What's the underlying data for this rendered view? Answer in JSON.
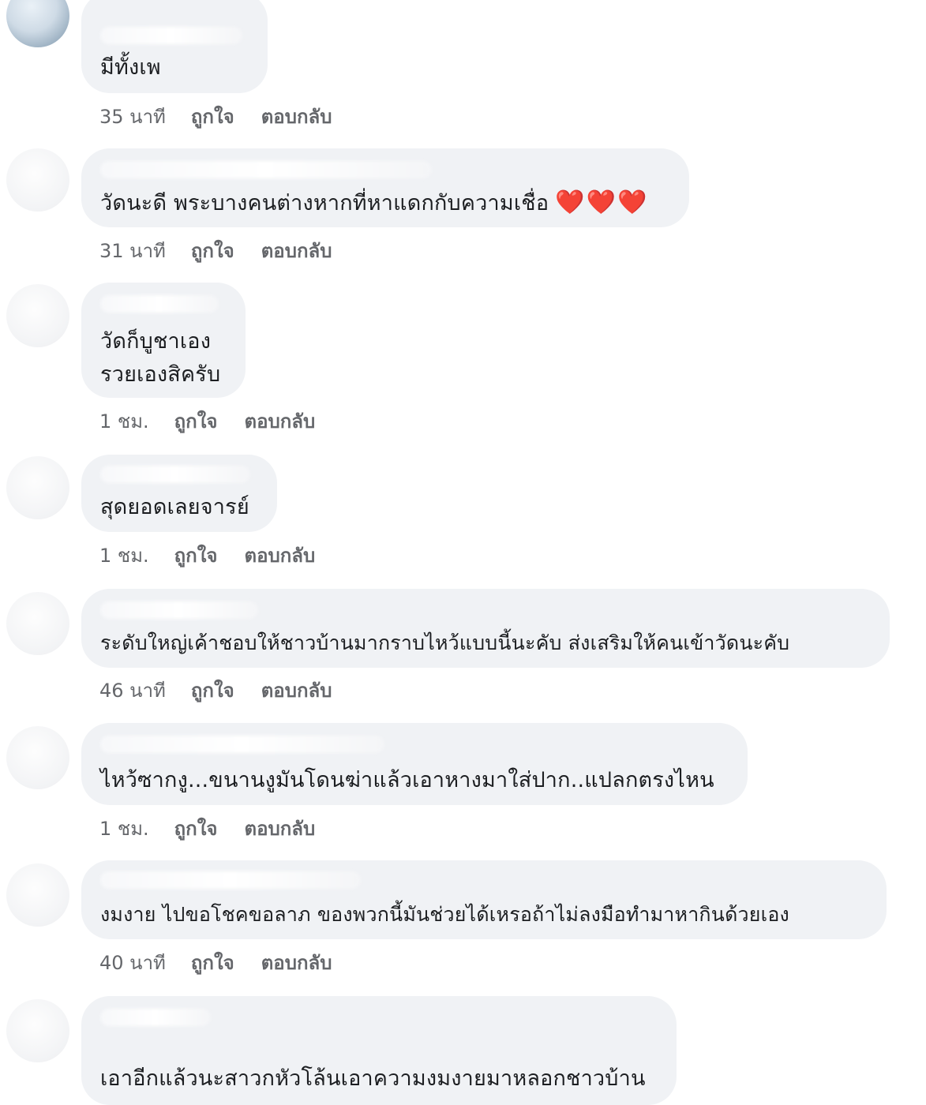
{
  "labels": {
    "like": "ถูกใจ",
    "reply": "ตอบกลับ"
  },
  "comments": [
    {
      "text_lines": [
        "มีทั้งเพ"
      ],
      "time": "35 นาที",
      "avatar_icon": "profile-photo-icon"
    },
    {
      "text_lines": [
        "วัดนะดี พระบางคนต่างหากที่หาแดกกับความเชื่อ"
      ],
      "emoji": "❤️❤️❤️",
      "time": "31 นาที",
      "avatar_icon": "profile-photo-icon"
    },
    {
      "text_lines": [
        "วัดก็บูชาเอง",
        "รวยเองสิครับ"
      ],
      "time": "1 ชม.",
      "avatar_icon": "profile-photo-icon"
    },
    {
      "text_lines": [
        "สุดยอดเลยจารย์"
      ],
      "time": "1 ชม.",
      "avatar_icon": "profile-photo-icon"
    },
    {
      "text_lines": [
        "ระดับใหญ่เค้าชอบให้ชาวบ้านมากราบไหว้แบบนี้นะคับ ส่งเสริมให้คนเข้าวัดนะคับ"
      ],
      "time": "46 นาที",
      "avatar_icon": "profile-photo-icon"
    },
    {
      "text_lines": [
        "ไหว้ซากงู...ขนานงูมันโดนฆ่าแล้วเอาหางมาใส่ปาก..แปลกตรงไหน"
      ],
      "time": "1 ชม.",
      "avatar_icon": "profile-photo-icon"
    },
    {
      "text_lines": [
        "งมงาย ไปขอโชคขอลาภ ของพวกนี้มันช่วยได้เหรอถ้าไม่ลงมือทำมาหากินด้วยเอง"
      ],
      "time": "40 นาที",
      "avatar_icon": "profile-photo-icon"
    },
    {
      "text_lines": [
        "เอาอีกแล้วนะสาวกหัวโล้นเอาความงมงายมาหลอกชาวบ้าน"
      ],
      "time": "",
      "avatar_icon": "profile-photo-icon"
    }
  ]
}
